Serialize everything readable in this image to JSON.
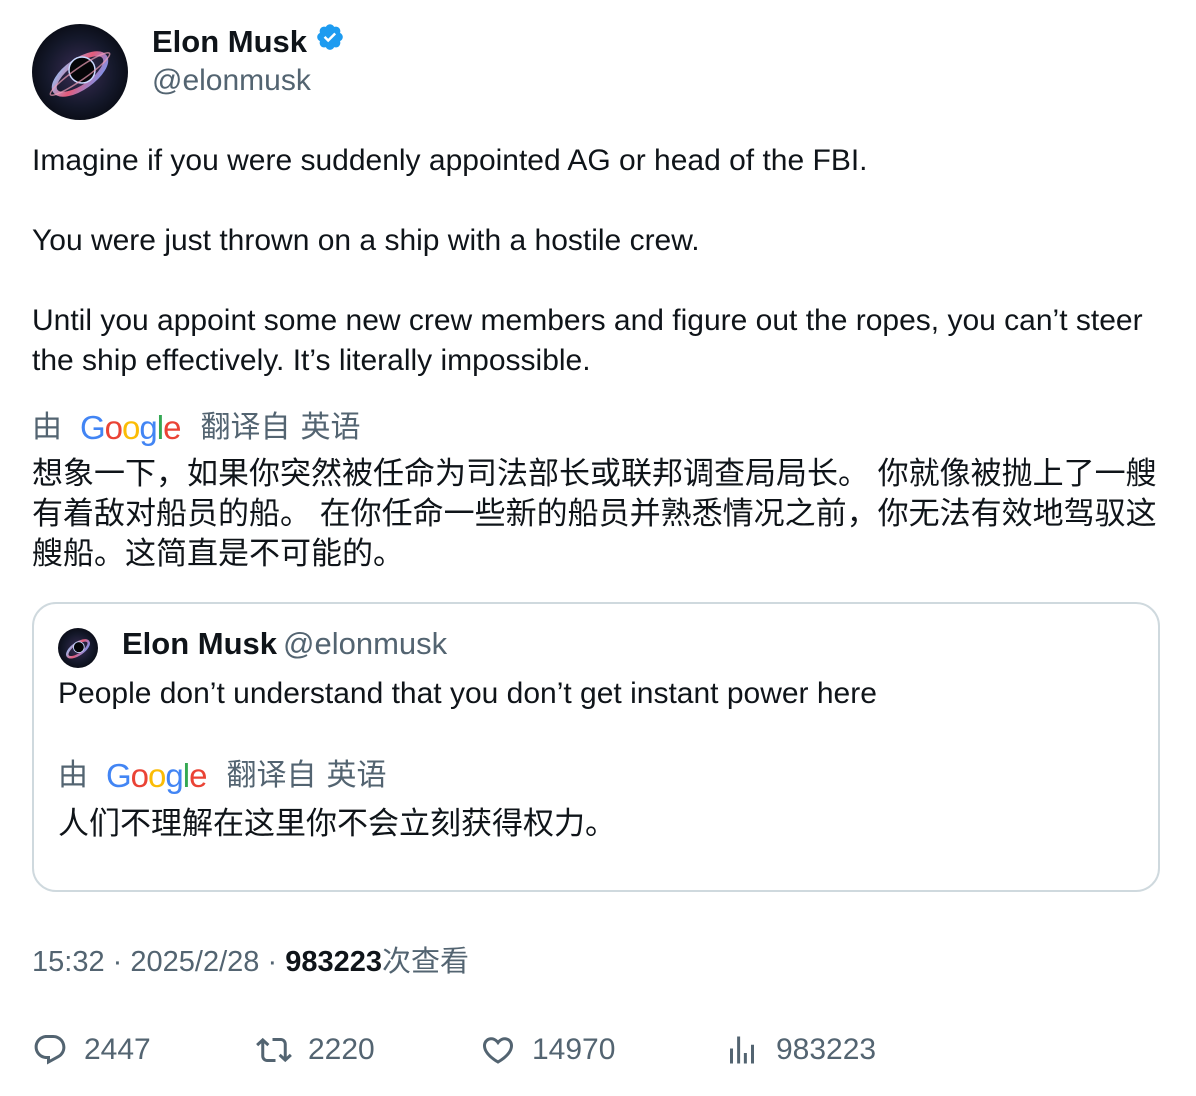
{
  "author": {
    "name": "Elon Musk",
    "handle": "@elonmusk",
    "verified": true,
    "verified_color": "#1d9bf0"
  },
  "tweet": {
    "paragraphs": [
      "Imagine if you were suddenly appointed AG or head of the FBI.",
      "You were just thrown on a ship with a hostile crew.",
      "Until you appoint some new crew members and figure out the ropes, you can’t steer the ship effectively. It’s literally impossible."
    ],
    "translation_label": {
      "by": "由",
      "provider": "Google",
      "translated_from": "翻译自",
      "language": "英语"
    },
    "translation": "想象一下，如果你突然被任命为司法部长或联邦调查局局长。 你就像被抛上了一艘有着敌对船员的船。 在你任命一些新的船员并熟悉情况之前，你无法有效地驾驭这艘船。这简直是不可能的。"
  },
  "quoted_tweet": {
    "name": "Elon Musk",
    "handle": "@elonmusk",
    "text": "People don’t understand that you don’t get instant power here",
    "translation_label": {
      "by": "由",
      "provider": "Google",
      "translated_from": "翻译自",
      "language": "英语"
    },
    "translation": "人们不理解在这里你不会立刻获得权力。"
  },
  "meta": {
    "time": "15:32",
    "separator": "·",
    "date": "2025/2/28",
    "views_count": "983223",
    "views_label": "次查看"
  },
  "actions": {
    "replies": "2447",
    "reposts": "2220",
    "likes": "14970",
    "views": "983223"
  }
}
